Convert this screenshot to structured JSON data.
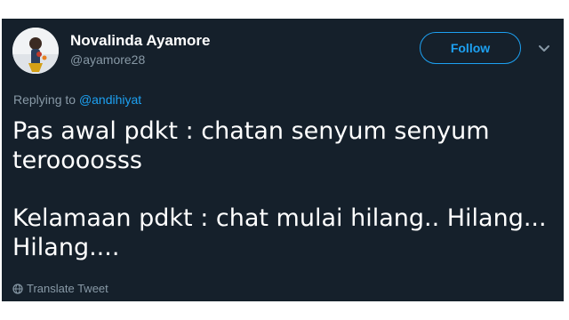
{
  "tweet": {
    "author": {
      "display_name": "Novalinda Ayamore",
      "handle": "@ayamore28"
    },
    "follow_label": "Follow",
    "reply": {
      "prefix": "Replying to ",
      "handle": "@andihiyat"
    },
    "text": {
      "line1": "Pas awal pdkt : chatan senyum senyum",
      "line2": "teroooosss",
      "line3": "Kelamaan pdkt : chat mulai hilang.. Hilang...",
      "line4": "Hilang...."
    },
    "translate_label": "Translate Tweet"
  },
  "colors": {
    "background": "#15202b",
    "accent": "#1da1f2",
    "secondary_text": "#8899a6",
    "primary_text": "#ffffff"
  },
  "icons": {
    "chevron": "chevron-down-icon",
    "translate": "globe-icon"
  }
}
